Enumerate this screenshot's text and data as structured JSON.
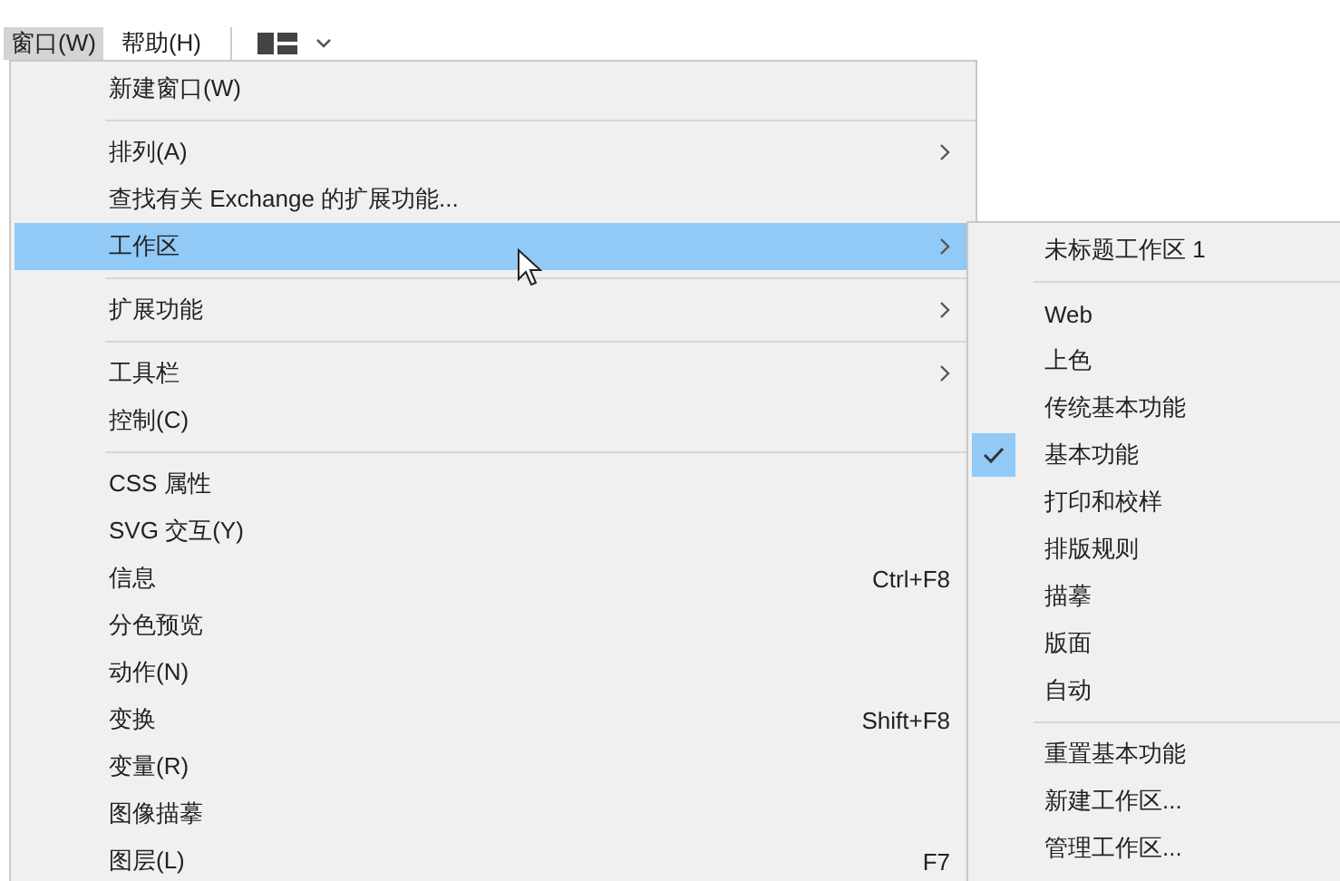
{
  "menu_bar": [
    {
      "label": "窗口(W)",
      "selected": true
    },
    {
      "label": "帮助(H)",
      "selected": false
    }
  ],
  "menu": {
    "items": [
      {
        "kind": "item",
        "label": "新建窗口(W)",
        "submenu": false,
        "selected": false
      },
      {
        "kind": "separator"
      },
      {
        "kind": "item",
        "label": "排列(A)",
        "submenu": true,
        "selected": false
      },
      {
        "kind": "item",
        "label": "查找有关 Exchange 的扩展功能...",
        "submenu": false,
        "selected": false
      },
      {
        "kind": "item",
        "label": "工作区",
        "submenu": true,
        "selected": true
      },
      {
        "kind": "separator"
      },
      {
        "kind": "item",
        "label": "扩展功能",
        "submenu": true,
        "selected": false
      },
      {
        "kind": "separator"
      },
      {
        "kind": "item",
        "label": "工具栏",
        "submenu": true,
        "selected": false
      },
      {
        "kind": "item",
        "label": "控制(C)",
        "submenu": false,
        "selected": false
      },
      {
        "kind": "separator"
      },
      {
        "kind": "item",
        "label": "CSS 属性",
        "submenu": false,
        "selected": false
      },
      {
        "kind": "item",
        "label": "SVG 交互(Y)",
        "submenu": false,
        "selected": false
      },
      {
        "kind": "item",
        "label": "信息",
        "shortcut": "Ctrl+F8",
        "submenu": false,
        "selected": false
      },
      {
        "kind": "item",
        "label": "分色预览",
        "submenu": false,
        "selected": false
      },
      {
        "kind": "item",
        "label": "动作(N)",
        "submenu": false,
        "selected": false
      },
      {
        "kind": "item",
        "label": "变换",
        "shortcut": "Shift+F8",
        "submenu": false,
        "selected": false
      },
      {
        "kind": "item",
        "label": "变量(R)",
        "submenu": false,
        "selected": false
      },
      {
        "kind": "item",
        "label": "图像描摹",
        "submenu": false,
        "selected": false
      },
      {
        "kind": "item",
        "label": "图层(L)",
        "shortcut": "F7",
        "submenu": false,
        "selected": false
      }
    ]
  },
  "submenu": {
    "items": [
      {
        "kind": "item",
        "label": "未标题工作区 1",
        "checked": false
      },
      {
        "kind": "separator"
      },
      {
        "kind": "item",
        "label": "Web",
        "checked": false
      },
      {
        "kind": "item",
        "label": "上色",
        "checked": false
      },
      {
        "kind": "item",
        "label": "传统基本功能",
        "checked": false
      },
      {
        "kind": "item",
        "label": "基本功能",
        "checked": true
      },
      {
        "kind": "item",
        "label": "打印和校样",
        "checked": false
      },
      {
        "kind": "item",
        "label": "排版规则",
        "checked": false
      },
      {
        "kind": "item",
        "label": "描摹",
        "checked": false
      },
      {
        "kind": "item",
        "label": "版面",
        "checked": false
      },
      {
        "kind": "item",
        "label": "自动",
        "checked": false
      },
      {
        "kind": "separator"
      },
      {
        "kind": "item",
        "label": "重置基本功能",
        "checked": false
      },
      {
        "kind": "item",
        "label": "新建工作区...",
        "checked": false
      },
      {
        "kind": "item",
        "label": "管理工作区...",
        "checked": false
      }
    ]
  }
}
